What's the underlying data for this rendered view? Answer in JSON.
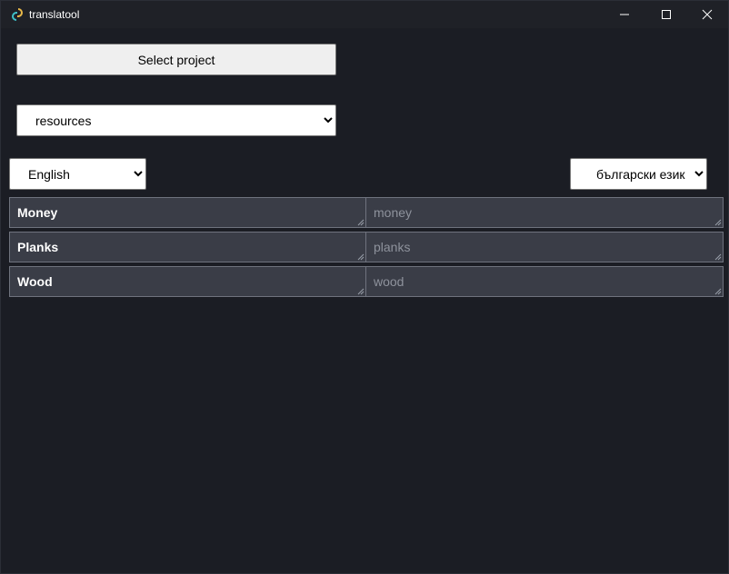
{
  "window": {
    "title": "translatool",
    "controls": {
      "minimize": "minimize-icon",
      "maximize": "maximize-icon",
      "close": "close-icon"
    }
  },
  "toolbar": {
    "select_project_label": "Select project",
    "resource_select": {
      "selected": "resources"
    },
    "source_language": {
      "selected": "English"
    },
    "target_language": {
      "selected": "български език"
    }
  },
  "rows": [
    {
      "key": "Money",
      "placeholder": "money"
    },
    {
      "key": "Planks",
      "placeholder": "planks"
    },
    {
      "key": "Wood",
      "placeholder": "wood"
    }
  ],
  "colors": {
    "background": "#1b1d24",
    "titlebar": "#1f2127",
    "cell_background": "#3a3d47",
    "cell_border": "#6f737e",
    "placeholder_text": "#8e929c"
  }
}
